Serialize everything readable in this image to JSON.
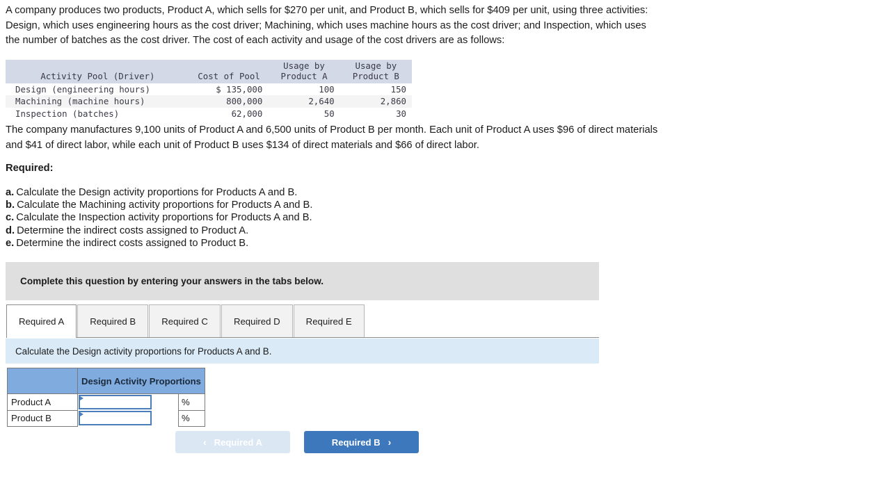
{
  "intro": {
    "paragraph": "A company produces two products, Product A, which sells for $270 per unit, and Product B, which sells for $409 per unit, using three activities: Design, which uses engineering hours as the cost driver; Machining, which uses machine hours as the cost driver; and Inspection, which uses the number of batches as the cost driver. The cost of each activity and usage of the cost drivers are as follows:"
  },
  "activity_table": {
    "headers": {
      "pool": "Activity Pool (Driver)",
      "cost": "Cost of Pool",
      "usage_a": "Usage by\nProduct A",
      "usage_b": "Usage by\nProduct B"
    },
    "rows": [
      {
        "pool": "Design (engineering hours)",
        "cost": "$ 135,000",
        "usage_a": "100",
        "usage_b": "150"
      },
      {
        "pool": "Machining (machine hours)",
        "cost": "800,000",
        "usage_a": "2,640",
        "usage_b": "2,860"
      },
      {
        "pool": "Inspection (batches)",
        "cost": "62,000",
        "usage_a": "50",
        "usage_b": "30"
      }
    ]
  },
  "manufacture": {
    "paragraph": "The company manufactures 9,100 units of Product A and 6,500 units of Product B per month. Each unit of Product A uses $96 of direct materials and $41 of direct labor, while each unit of Product B uses $134 of direct materials and $66 of direct labor."
  },
  "required": {
    "heading": "Required:",
    "items": [
      {
        "marker": "a.",
        "text": "Calculate the Design activity proportions for Products A and B."
      },
      {
        "marker": "b.",
        "text": "Calculate the Machining activity proportions for Products A and B."
      },
      {
        "marker": "c.",
        "text": "Calculate the Inspection activity proportions for Products A and B."
      },
      {
        "marker": "d.",
        "text": "Determine the indirect costs assigned to Product A."
      },
      {
        "marker": "e.",
        "text": "Determine the indirect costs assigned to Product B."
      }
    ]
  },
  "complete_bar": {
    "text": "Complete this question by entering your answers in the tabs below."
  },
  "tabs": [
    {
      "label": "Required A",
      "active": true
    },
    {
      "label": "Required B",
      "active": false
    },
    {
      "label": "Required C",
      "active": false
    },
    {
      "label": "Required D",
      "active": false
    },
    {
      "label": "Required E",
      "active": false
    }
  ],
  "tab_prompt": {
    "text": "Calculate the Design activity proportions for Products A and B."
  },
  "answer_table": {
    "header_blank": "",
    "header_title": "Design Activity Proportions",
    "rows": [
      {
        "label": "Product A",
        "value": "",
        "unit": "%"
      },
      {
        "label": "Product B",
        "value": "",
        "unit": "%"
      }
    ]
  },
  "nav": {
    "prev_label": "Required A",
    "prev_chevron": "‹",
    "next_label": "Required B",
    "next_chevron": "›"
  },
  "colors": {
    "accent_blue": "#3d78bd",
    "header_blue": "#7fabdf",
    "prompt_blue": "#daeaf7",
    "bar_grey": "#dfdfdf",
    "table_header_grey": "#d3d9e6"
  }
}
